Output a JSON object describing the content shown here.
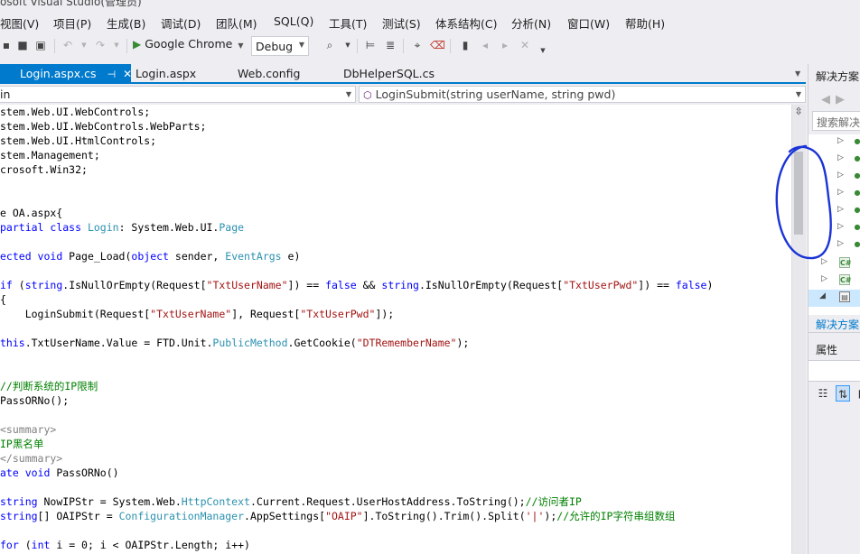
{
  "window": {
    "title": "osoft Visual Studio(管理员)"
  },
  "menu": [
    "视图(V)",
    "项目(P)",
    "生成(B)",
    "调试(D)",
    "团队(M)",
    "SQL(Q)",
    "工具(T)",
    "测试(S)",
    "体系结构(C)",
    "分析(N)",
    "窗口(W)",
    "帮助(H)"
  ],
  "toolbar": {
    "run_target": "Google Chrome",
    "configuration": "Debug",
    "icons": [
      "save-icon",
      "save-all-icon",
      "undo-icon",
      "redo-icon",
      "start-icon",
      "find-icon",
      "format-icon",
      "comment-icon",
      "uncomment-icon",
      "bookmark-icon"
    ]
  },
  "tabs": [
    {
      "label": "Login.aspx.cs",
      "active": true
    },
    {
      "label": "Login.aspx",
      "active": false
    },
    {
      "label": "Web.config",
      "active": false
    },
    {
      "label": "DbHelperSQL.cs",
      "active": false
    }
  ],
  "navbar": {
    "type": "in",
    "member": "LoginSubmit(string userName, string pwd)"
  },
  "code": {
    "lines": [
      [
        "stem.Web.UI.WebControls;"
      ],
      [
        "stem.Web.UI.WebControls.WebParts;"
      ],
      [
        "stem.Web.UI.HtmlControls;"
      ],
      [
        "stem.Management;"
      ],
      [
        "crosoft.Win32;"
      ],
      [
        ""
      ],
      [
        ""
      ],
      [
        "e OA.aspx{"
      ],
      [
        "partial ",
        "class ",
        "Login",
        ": System.Web.UI.",
        "Page"
      ],
      [
        ""
      ],
      [
        "ected ",
        "void ",
        "Page_Load(",
        "object ",
        "sender, ",
        "EventArgs ",
        "e)"
      ],
      [
        ""
      ],
      [
        "if ",
        "(",
        "string",
        ".IsNullOrEmpty(Request[",
        "\"TxtUserName\"",
        "]) == ",
        "false ",
        "&& ",
        "string",
        ".IsNullOrEmpty(Request[",
        "\"TxtUserPwd\"",
        "]) == ",
        "false",
        ")"
      ],
      [
        "{"
      ],
      [
        "    LoginSubmit(Request[",
        "\"TxtUserName\"",
        "], Request[",
        "\"TxtUserPwd\"",
        "]);"
      ],
      [
        ""
      ],
      [
        "this",
        ".TxtUserName.Value = FTD.Unit.",
        "PublicMethod",
        ".GetCookie(",
        "\"DTRememberName\"",
        ");"
      ],
      [
        ""
      ],
      [
        ""
      ],
      [
        "//判断系统的IP限制"
      ],
      [
        "PassORNo();"
      ],
      [
        ""
      ],
      [
        "<summary>"
      ],
      [
        "IP黑名单"
      ],
      [
        "</summary>"
      ],
      [
        "ate ",
        "void ",
        "PassORNo()"
      ],
      [
        ""
      ],
      [
        "string ",
        "NowIPStr = System.Web.",
        "HttpContext",
        ".Current.Request.UserHostAddress.ToString();",
        "//访问者IP"
      ],
      [
        "string",
        "[] OAIPStr = ",
        "ConfigurationManager",
        ".AppSettings[",
        "\"OAIP\"",
        "].ToString().Trim().Split(",
        "'|'",
        ");",
        "//允许的IP字符串组数组"
      ],
      [
        ""
      ],
      [
        "for ",
        "(",
        "int ",
        "i = 0; i < OAIPStr.Length; i++)"
      ]
    ],
    "kinds": [
      [
        "p"
      ],
      [
        "p"
      ],
      [
        "p"
      ],
      [
        "p"
      ],
      [
        "p"
      ],
      [
        ""
      ],
      [
        ""
      ],
      [
        "p"
      ],
      [
        "k",
        "k",
        "t",
        "p",
        "t"
      ],
      [
        ""
      ],
      [
        "k",
        "k",
        "p",
        "k",
        "p",
        "t",
        "p"
      ],
      [
        ""
      ],
      [
        "k",
        "p",
        "k",
        "p",
        "s",
        "p",
        "k",
        "p",
        "k",
        "p",
        "s",
        "p",
        "k",
        "p"
      ],
      [
        "p"
      ],
      [
        "p",
        "s",
        "p",
        "s",
        "p"
      ],
      [
        ""
      ],
      [
        "k",
        "p",
        "t",
        "p",
        "s",
        "p"
      ],
      [
        ""
      ],
      [
        ""
      ],
      [
        "c"
      ],
      [
        "p"
      ],
      [
        ""
      ],
      [
        "g"
      ],
      [
        "c"
      ],
      [
        "g"
      ],
      [
        "k",
        "k",
        "p"
      ],
      [
        ""
      ],
      [
        "k",
        "p",
        "t",
        "p",
        "c"
      ],
      [
        "k",
        "p",
        "t",
        "p",
        "s",
        "p",
        "s",
        "p",
        "c"
      ],
      [
        ""
      ],
      [
        "k",
        "p",
        "k",
        "p"
      ]
    ]
  },
  "solution_explorer": {
    "title": "解决方案",
    "search_placeholder": "搜索解决",
    "bottom_tab": "解决方案",
    "properties_title": "属性"
  }
}
